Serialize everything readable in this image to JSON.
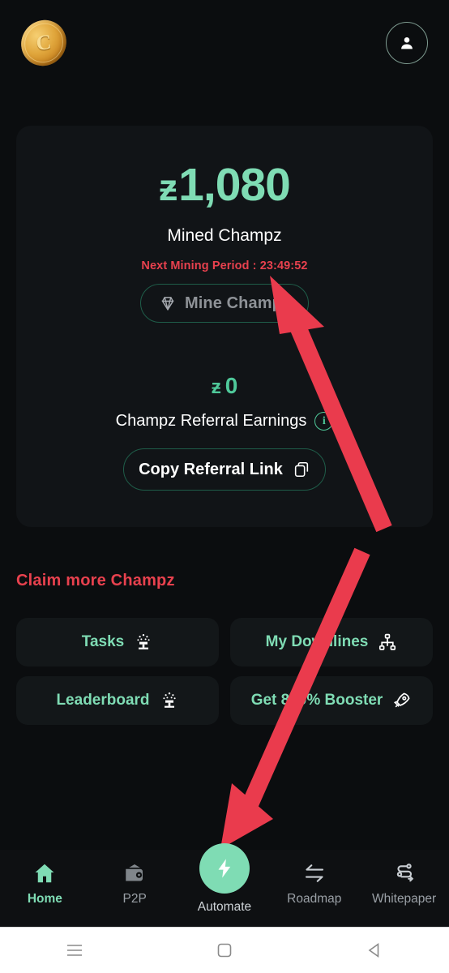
{
  "header": {
    "logo_icon": "gold-coin-icon",
    "logo_letter": "C",
    "profile_icon": "user-avatar-icon"
  },
  "main_card": {
    "balance_symbol": "ƶ",
    "balance_value": "1,080",
    "balance_label": "Mined Champz",
    "next_mining": "Next Mining Period : 23:49:52",
    "mine_button": {
      "label": "Mine Champz",
      "icon": "diamond-icon",
      "disabled": true
    },
    "referral_symbol": "ƶ",
    "referral_value": "0",
    "referral_label": "Champz Referral Earnings",
    "info_icon": "info-icon",
    "info_glyph": "i",
    "copy_button": {
      "label": "Copy Referral Link",
      "icon": "copy-icon"
    }
  },
  "claim_section": {
    "title": "Claim more Champz",
    "tiles": [
      {
        "label": "Tasks",
        "icon": "podium-celebration-icon"
      },
      {
        "label": "My Downlines",
        "icon": "org-hierarchy-icon"
      },
      {
        "label": "Leaderboard",
        "icon": "podium-celebration-icon"
      },
      {
        "label": "Get 800% Booster",
        "icon": "rocket-icon"
      }
    ]
  },
  "bottom_nav": {
    "items": [
      {
        "label": "Home",
        "icon": "home-icon",
        "active": true
      },
      {
        "label": "P2P",
        "icon": "wallet-icon",
        "active": false
      },
      {
        "label": "Automate",
        "icon": "lightning-bolt-icon",
        "active": false
      },
      {
        "label": "Roadmap",
        "icon": "swap-arrows-icon",
        "active": false
      },
      {
        "label": "Whitepaper",
        "icon": "route-path-icon",
        "active": false
      }
    ]
  },
  "system_bar": {
    "recents_icon": "menu-lines-icon",
    "home_icon": "square-icon",
    "back_icon": "triangle-back-icon"
  },
  "annotations": {
    "arrow_color": "#ea3b4d",
    "arrow_1_target": "mine-champz-button",
    "arrow_2_target": "automate-nav-button"
  },
  "colors": {
    "accent_green": "#7fdcb4",
    "accent_red": "#e8414e",
    "page_bg": "#0b0d0f",
    "card_bg": "#111417"
  }
}
